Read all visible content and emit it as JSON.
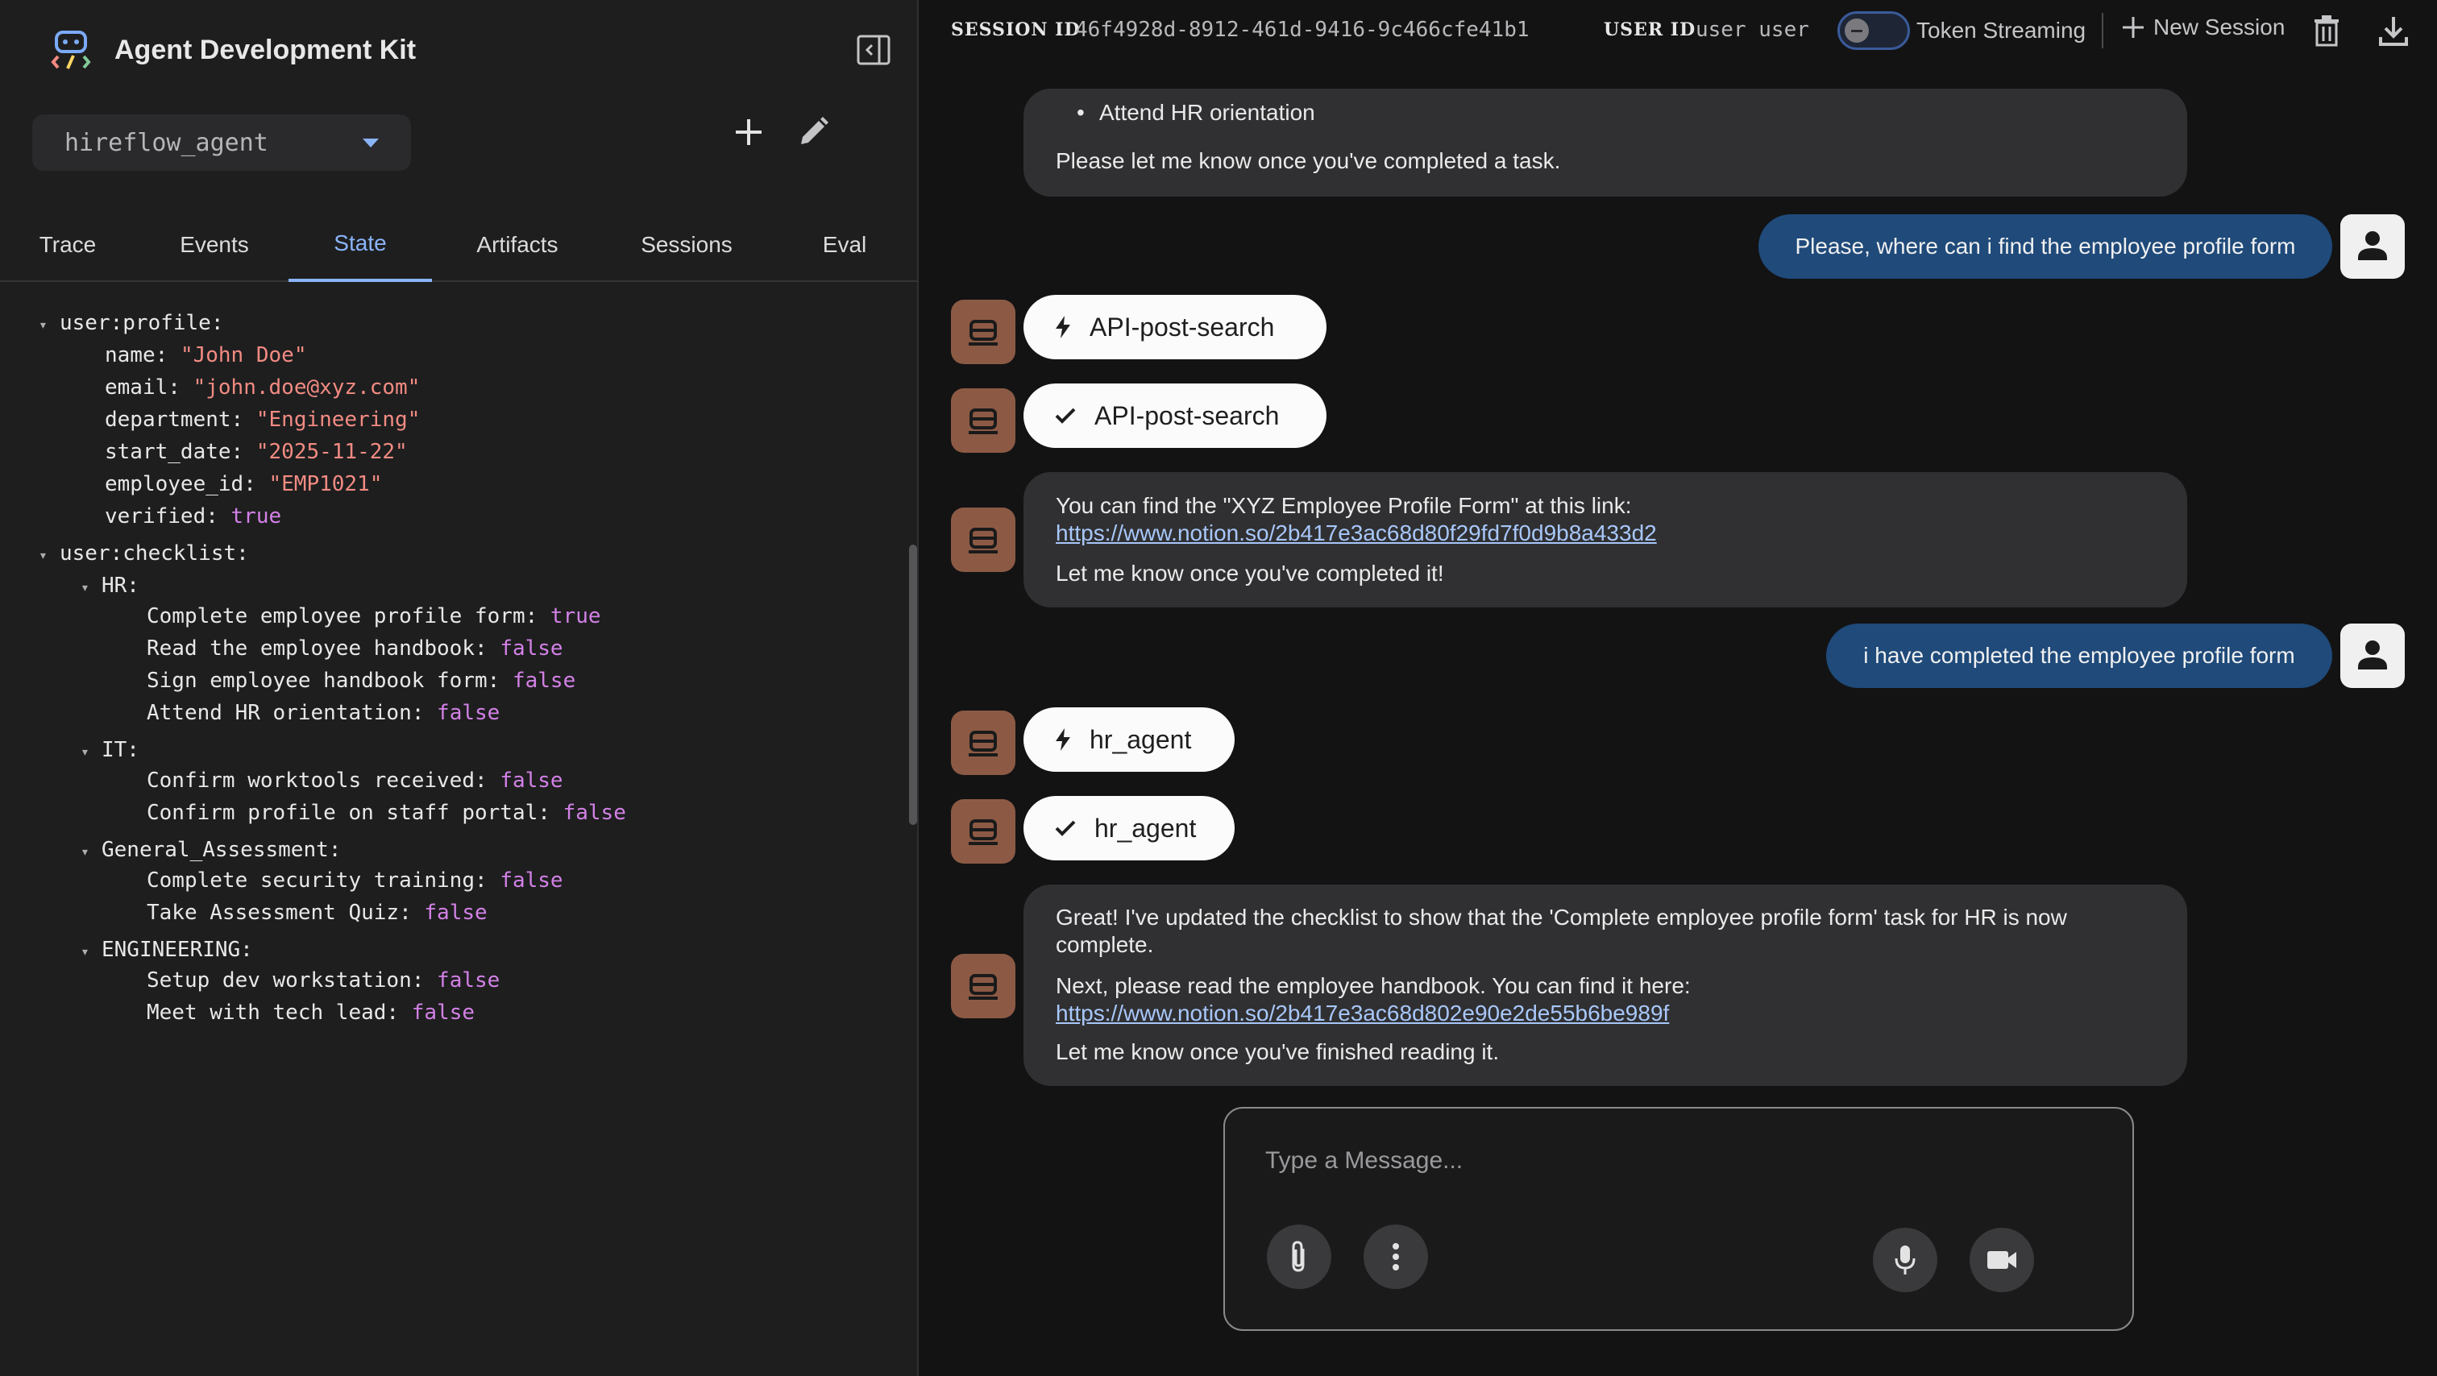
{
  "app": {
    "title": "Agent Development Kit"
  },
  "agent": {
    "selected": "hireflow_agent"
  },
  "tabs": [
    "Trace",
    "Events",
    "State",
    "Artifacts",
    "Sessions",
    "Eval"
  ],
  "state": {
    "profile_key": "user:profile:",
    "profile": [
      {
        "k": "name",
        "v": "\"John Doe\"",
        "t": "str"
      },
      {
        "k": "email",
        "v": "\"john.doe@xyz.com\"",
        "t": "str"
      },
      {
        "k": "department",
        "v": "\"Engineering\"",
        "t": "str"
      },
      {
        "k": "start_date",
        "v": "\"2025-11-22\"",
        "t": "str"
      },
      {
        "k": "employee_id",
        "v": "\"EMP1021\"",
        "t": "str"
      },
      {
        "k": "verified",
        "v": "true",
        "t": "bool"
      }
    ],
    "checklist_key": "user:checklist:",
    "groups": [
      {
        "name": "HR:",
        "items": [
          {
            "k": "Complete employee profile form",
            "v": "true"
          },
          {
            "k": "Read the employee handbook",
            "v": "false"
          },
          {
            "k": "Sign employee handbook form",
            "v": "false"
          },
          {
            "k": "Attend HR orientation",
            "v": "false"
          }
        ]
      },
      {
        "name": "IT:",
        "items": [
          {
            "k": "Confirm worktools received",
            "v": "false"
          },
          {
            "k": "Confirm profile on staff portal",
            "v": "false"
          }
        ]
      },
      {
        "name": "General_Assessment:",
        "items": [
          {
            "k": "Complete security training",
            "v": "false"
          },
          {
            "k": "Take Assessment Quiz",
            "v": "false"
          }
        ]
      },
      {
        "name": "ENGINEERING:",
        "items": [
          {
            "k": "Setup dev workstation",
            "v": "false"
          },
          {
            "k": "Meet with tech lead",
            "v": "false"
          }
        ]
      }
    ]
  },
  "session": {
    "session_label": "SESSION ID",
    "session_id": "46f4928d-8912-461d-9416-9c466cfe41b1",
    "user_label": "USER ID",
    "user_id": "user user",
    "streaming_label": "Token Streaming",
    "new_session_label": "New Session"
  },
  "chat": {
    "top_bullet": "Attend HR orientation",
    "top_line": "Please let me know once you've completed a task.",
    "user_msg_1": "Please, where can i find the employee profile form",
    "tool_call_1": "API-post-search",
    "tool_result_1": "API-post-search",
    "bot_msg_1_line1": "You can find the \"XYZ Employee Profile Form\" at this link:",
    "bot_msg_1_link": "https://www.notion.so/2b417e3ac68d80f29fd7f0d9b8a433d2",
    "bot_msg_1_line2": "Let me know once you've completed it!",
    "user_msg_2": "i have completed the employee profile form",
    "tool_call_2": "hr_agent",
    "tool_result_2": "hr_agent",
    "bot_msg_2_line1": "Great! I've updated the checklist to show that the 'Complete employee profile form' task for HR is now complete.",
    "bot_msg_2_line2": "Next, please read the employee handbook. You can find it here:",
    "bot_msg_2_link": "https://www.notion.so/2b417e3ac68d802e90e2de55b6be989f",
    "bot_msg_2_line3": "Let me know once you've finished reading it."
  },
  "composer": {
    "placeholder": "Type a Message..."
  }
}
